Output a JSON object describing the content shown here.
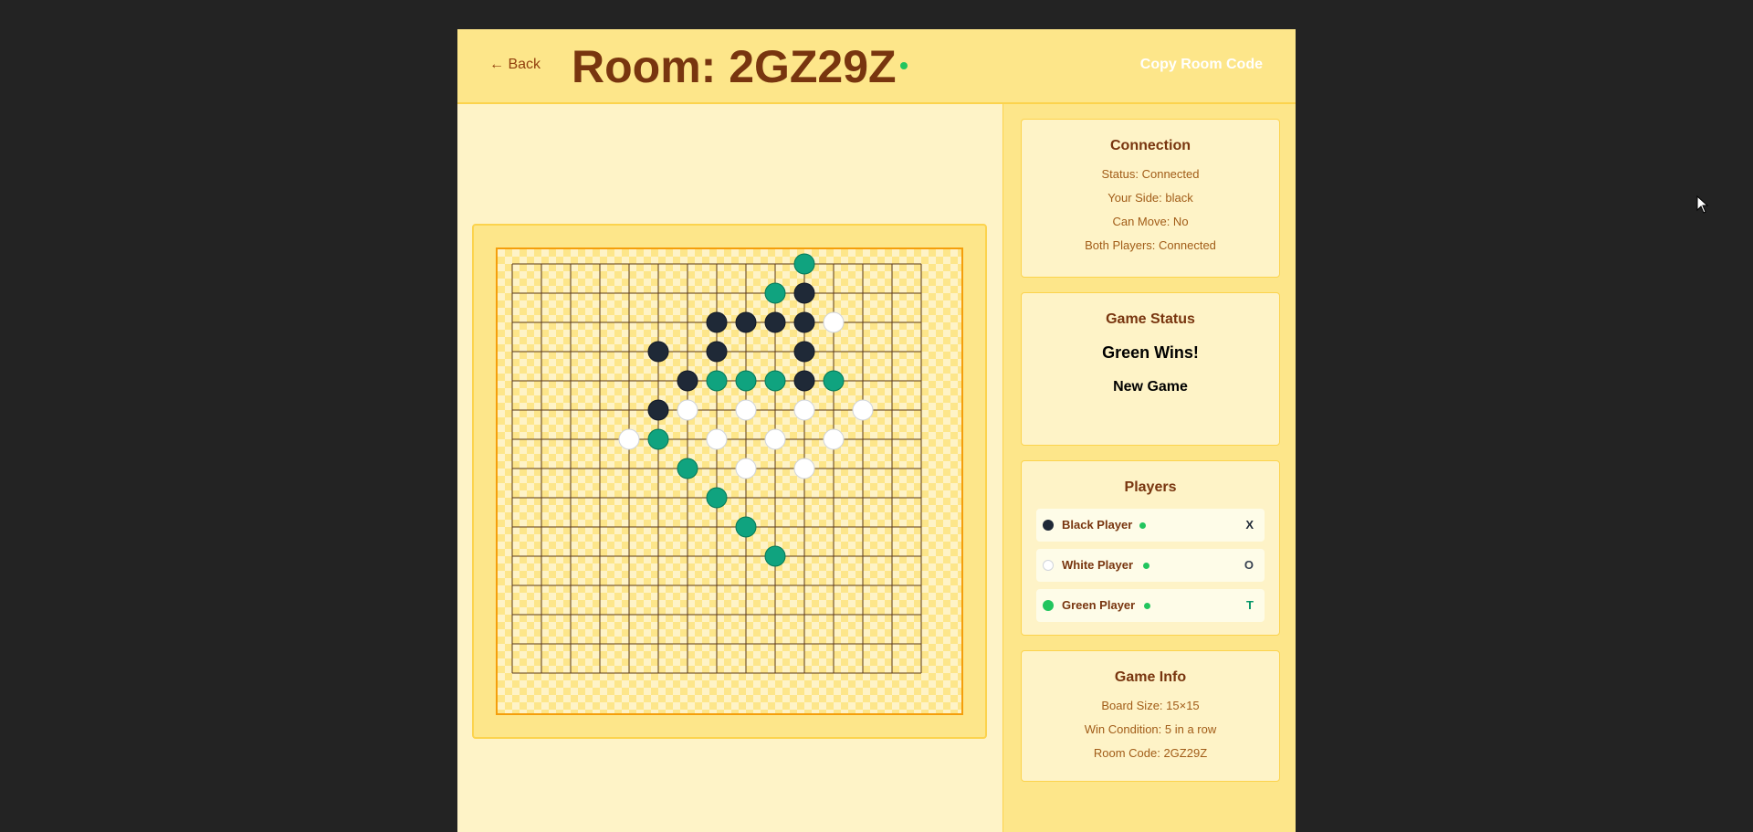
{
  "header": {
    "back_label": "← Back",
    "room_title": "Room: 2GZ29Z",
    "copy_label": "Copy Room Code"
  },
  "connection": {
    "title": "Connection",
    "status": "Status: Connected",
    "side": "Your Side: black",
    "can_move": "Can Move: No",
    "both": "Both Players: Connected"
  },
  "game_status": {
    "title": "Game Status",
    "result": "Green Wins!",
    "new_game_label": "New Game"
  },
  "players": {
    "title": "Players",
    "list": [
      {
        "name": "Black Player",
        "symbol": "X",
        "stone": "#1f2937",
        "symbol_color": "#1f2937"
      },
      {
        "name": "White Player",
        "symbol": "O",
        "stone": "#ffffff",
        "symbol_color": "#374151"
      },
      {
        "name": "Green Player",
        "symbol": "T",
        "stone": "#10a37f",
        "symbol_color": "#059669"
      }
    ]
  },
  "game_info": {
    "title": "Game Info",
    "board_size": "Board Size: 15×15",
    "win_condition": "Win Condition: 5 in a row",
    "room_code": "Room Code: 2GZ29Z"
  },
  "board": {
    "size": 15,
    "colors": {
      "black": "#1f2937",
      "white": "#ffffff",
      "green": "#10a37f",
      "line": "#5b3a1a"
    },
    "stones": [
      {
        "row": 0,
        "col": 10,
        "color": "green"
      },
      {
        "row": 1,
        "col": 9,
        "color": "green"
      },
      {
        "row": 1,
        "col": 10,
        "color": "black"
      },
      {
        "row": 2,
        "col": 7,
        "color": "black"
      },
      {
        "row": 2,
        "col": 8,
        "color": "black"
      },
      {
        "row": 2,
        "col": 9,
        "color": "black"
      },
      {
        "row": 2,
        "col": 10,
        "color": "black"
      },
      {
        "row": 2,
        "col": 11,
        "color": "white"
      },
      {
        "row": 3,
        "col": 5,
        "color": "black"
      },
      {
        "row": 3,
        "col": 7,
        "color": "black"
      },
      {
        "row": 3,
        "col": 10,
        "color": "black"
      },
      {
        "row": 4,
        "col": 6,
        "color": "black"
      },
      {
        "row": 4,
        "col": 7,
        "color": "green"
      },
      {
        "row": 4,
        "col": 8,
        "color": "green"
      },
      {
        "row": 4,
        "col": 9,
        "color": "green"
      },
      {
        "row": 4,
        "col": 10,
        "color": "black"
      },
      {
        "row": 4,
        "col": 11,
        "color": "green"
      },
      {
        "row": 5,
        "col": 5,
        "color": "black"
      },
      {
        "row": 5,
        "col": 6,
        "color": "white"
      },
      {
        "row": 5,
        "col": 8,
        "color": "white"
      },
      {
        "row": 5,
        "col": 10,
        "color": "white"
      },
      {
        "row": 5,
        "col": 12,
        "color": "white"
      },
      {
        "row": 6,
        "col": 4,
        "color": "white"
      },
      {
        "row": 6,
        "col": 5,
        "color": "green"
      },
      {
        "row": 6,
        "col": 7,
        "color": "white"
      },
      {
        "row": 6,
        "col": 9,
        "color": "white"
      },
      {
        "row": 6,
        "col": 11,
        "color": "white"
      },
      {
        "row": 7,
        "col": 6,
        "color": "green"
      },
      {
        "row": 7,
        "col": 8,
        "color": "white"
      },
      {
        "row": 7,
        "col": 10,
        "color": "white"
      },
      {
        "row": 8,
        "col": 7,
        "color": "green"
      },
      {
        "row": 9,
        "col": 8,
        "color": "green"
      },
      {
        "row": 10,
        "col": 9,
        "color": "green"
      }
    ]
  }
}
